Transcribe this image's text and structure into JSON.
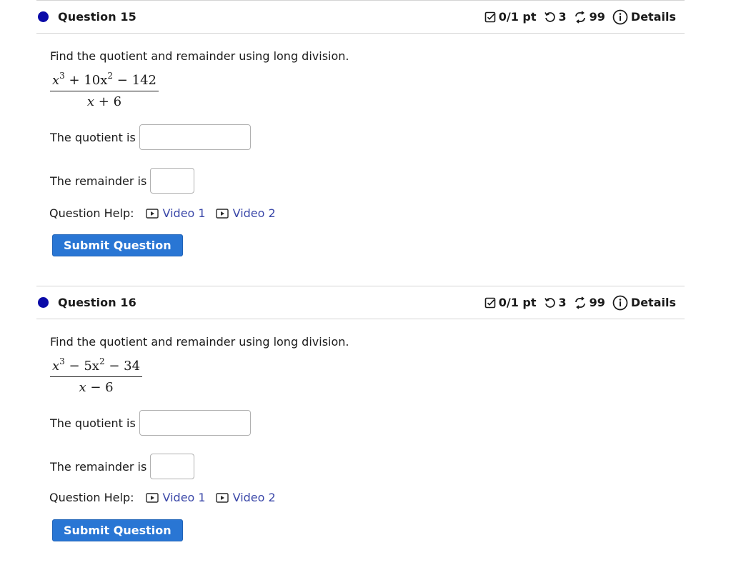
{
  "questions": [
    {
      "title": "Question 15",
      "score": "0/1 pt",
      "retries": "3",
      "attempts": "99",
      "details_label": "Details",
      "prompt": "Find the quotient and remainder using long division.",
      "numerator": {
        "t1": "x",
        "e1": "3",
        "op1": "+",
        "t2": "10x",
        "e2": "2",
        "op2": "−",
        "t3": "142"
      },
      "denominator": {
        "t1": "x",
        "op": "+",
        "t2": "6"
      },
      "quotient_label": "The quotient is",
      "quotient_value": "",
      "remainder_label": "The remainder is",
      "remainder_value": "",
      "help_label": "Question Help:",
      "video1": "Video 1",
      "video2": "Video 2",
      "submit_label": "Submit Question"
    },
    {
      "title": "Question 16",
      "score": "0/1 pt",
      "retries": "3",
      "attempts": "99",
      "details_label": "Details",
      "prompt": "Find the quotient and remainder using long division.",
      "numerator": {
        "t1": "x",
        "e1": "3",
        "op1": "−",
        "t2": "5x",
        "e2": "2",
        "op2": "−",
        "t3": "34"
      },
      "denominator": {
        "t1": "x",
        "op": "−",
        "t2": "6"
      },
      "quotient_label": "The quotient is",
      "quotient_value": "",
      "remainder_label": "The remainder is",
      "remainder_value": "",
      "help_label": "Question Help:",
      "video1": "Video 1",
      "video2": "Video 2",
      "submit_label": "Submit Question"
    }
  ],
  "icons": {
    "score": "checkbox-icon",
    "retries": "retry-icon",
    "attempts": "attempts-icon",
    "details": "info-icon",
    "video": "play-icon"
  },
  "colors": {
    "status_dot": "#0a0aa8",
    "submit_button": "#2976d4",
    "link": "#3a47a8"
  }
}
